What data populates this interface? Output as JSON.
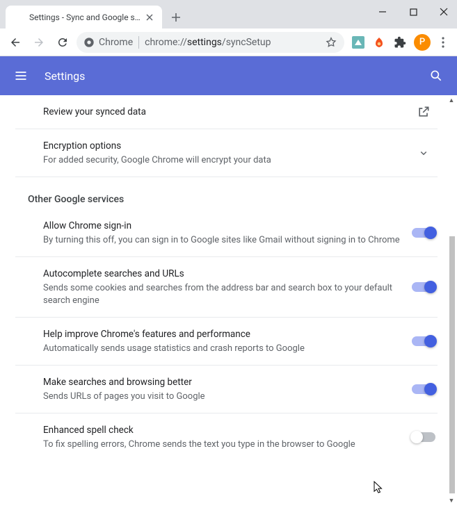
{
  "window": {
    "tab_title": "Settings - Sync and Google servic"
  },
  "omnibox": {
    "chip_label": "Chrome",
    "url_prefix": "chrome://",
    "url_bold": "settings",
    "url_suffix": "/syncSetup"
  },
  "avatar": {
    "initial": "P"
  },
  "header": {
    "title": "Settings"
  },
  "rows": {
    "review": {
      "title": "Review your synced data"
    },
    "encryption": {
      "title": "Encryption options",
      "sub": "For added security, Google Chrome will encrypt your data"
    }
  },
  "section_other": {
    "header": "Other Google services",
    "items": [
      {
        "title": "Allow Chrome sign-in",
        "sub": "By turning this off, you can sign in to Google sites like Gmail without signing in to Chrome",
        "on": true
      },
      {
        "title": "Autocomplete searches and URLs",
        "sub": "Sends some cookies and searches from the address bar and search box to your default search engine",
        "on": true
      },
      {
        "title": "Help improve Chrome's features and performance",
        "sub": "Automatically sends usage statistics and crash reports to Google",
        "on": true
      },
      {
        "title": "Make searches and browsing better",
        "sub": "Sends URLs of pages you visit to Google",
        "on": true
      },
      {
        "title": "Enhanced spell check",
        "sub": "To fix spelling errors, Chrome sends the text you type in the browser to Google",
        "on": false
      }
    ]
  }
}
